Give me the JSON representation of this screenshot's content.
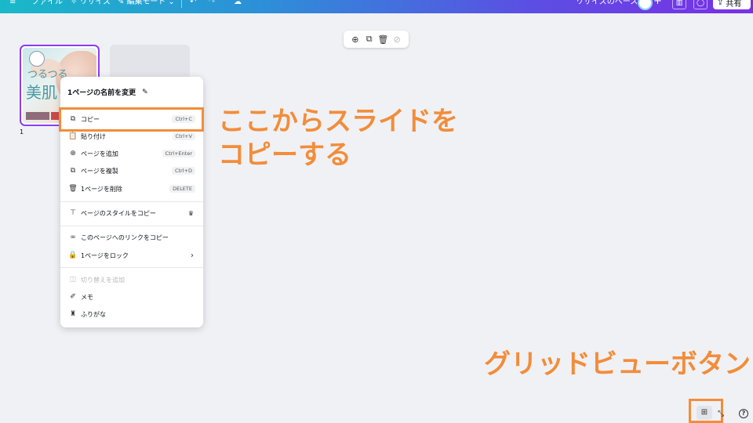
{
  "topbar": {
    "menu_icon": "hamburger-icon",
    "file": "ファイル",
    "resize": "リサイズ",
    "edit_mode": "編集モード",
    "brand_space": "リサイズのベース",
    "share": "共有"
  },
  "page_toolbar": {
    "icons": [
      "add-page-icon",
      "duplicate-page-icon",
      "delete-page-icon",
      "hide-page-icon"
    ]
  },
  "thumbnail": {
    "page_number": "1",
    "text_small": "つるつる",
    "text_large": "美肌"
  },
  "context_menu": {
    "title": "1ページの名前を変更",
    "items": [
      {
        "label": "コピー",
        "shortcut": "Ctrl+C",
        "icon": "copy-icon"
      },
      {
        "label": "貼り付け",
        "shortcut": "Ctrl+V",
        "icon": "paste-icon"
      },
      {
        "label": "ページを追加",
        "shortcut": "Ctrl+Enter",
        "icon": "add-page-icon"
      },
      {
        "label": "ページを複製",
        "shortcut": "Ctrl+D",
        "icon": "duplicate-icon"
      },
      {
        "label": "1ページを削除",
        "shortcut": "DELETE",
        "icon": "trash-icon"
      },
      {
        "label": "ページのスタイルをコピー",
        "icon": "paint-roller-icon"
      },
      {
        "label": "このページへのリンクをコピー",
        "icon": "link-icon"
      },
      {
        "label": "1ページをロック",
        "icon": "lock-icon"
      },
      {
        "label": "切り替えを追加",
        "icon": "transition-icon"
      },
      {
        "label": "メモ",
        "icon": "notes-icon"
      },
      {
        "label": "ふりがな",
        "icon": "furigana-icon"
      }
    ]
  },
  "annotations": {
    "copy_callout_line1": "ここからスライドを",
    "copy_callout_line2": "コピーする",
    "grid_callout": "グリッドビューボタン"
  },
  "colors": {
    "accent_orange": "#f28d3a",
    "selection_purple": "#8b3dff"
  }
}
